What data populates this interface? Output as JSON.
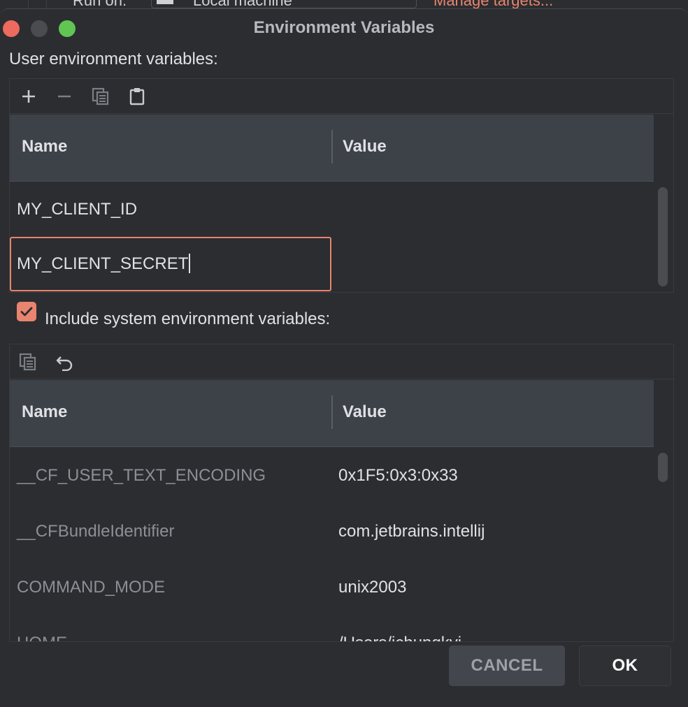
{
  "background": {
    "run_on_label": "Run on:",
    "target_value": "Local machine",
    "manage_link": "Manage targets..."
  },
  "window": {
    "title": "Environment Variables"
  },
  "user_section": {
    "label": "User environment variables:",
    "columns": {
      "name": "Name",
      "value": "Value"
    },
    "rows": [
      {
        "name": "MY_CLIENT_ID",
        "value": ""
      }
    ],
    "editing_name": "MY_CLIENT_SECRET"
  },
  "system_section": {
    "include_label": "Include system environment variables:",
    "include_checked": true,
    "columns": {
      "name": "Name",
      "value": "Value"
    },
    "rows": [
      {
        "name": "__CF_USER_TEXT_ENCODING",
        "value": "0x1F5:0x3:0x33"
      },
      {
        "name": "__CFBundleIdentifier",
        "value": "com.jetbrains.intellij"
      },
      {
        "name": "COMMAND_MODE",
        "value": "unix2003"
      },
      {
        "name": "HOME",
        "value": "/Users/jchungkyi"
      }
    ]
  },
  "footer": {
    "cancel_label": "CANCEL",
    "ok_label": "OK"
  },
  "colors": {
    "accent": "#e8846f",
    "background": "#2b2d30",
    "header": "#3d4148"
  }
}
